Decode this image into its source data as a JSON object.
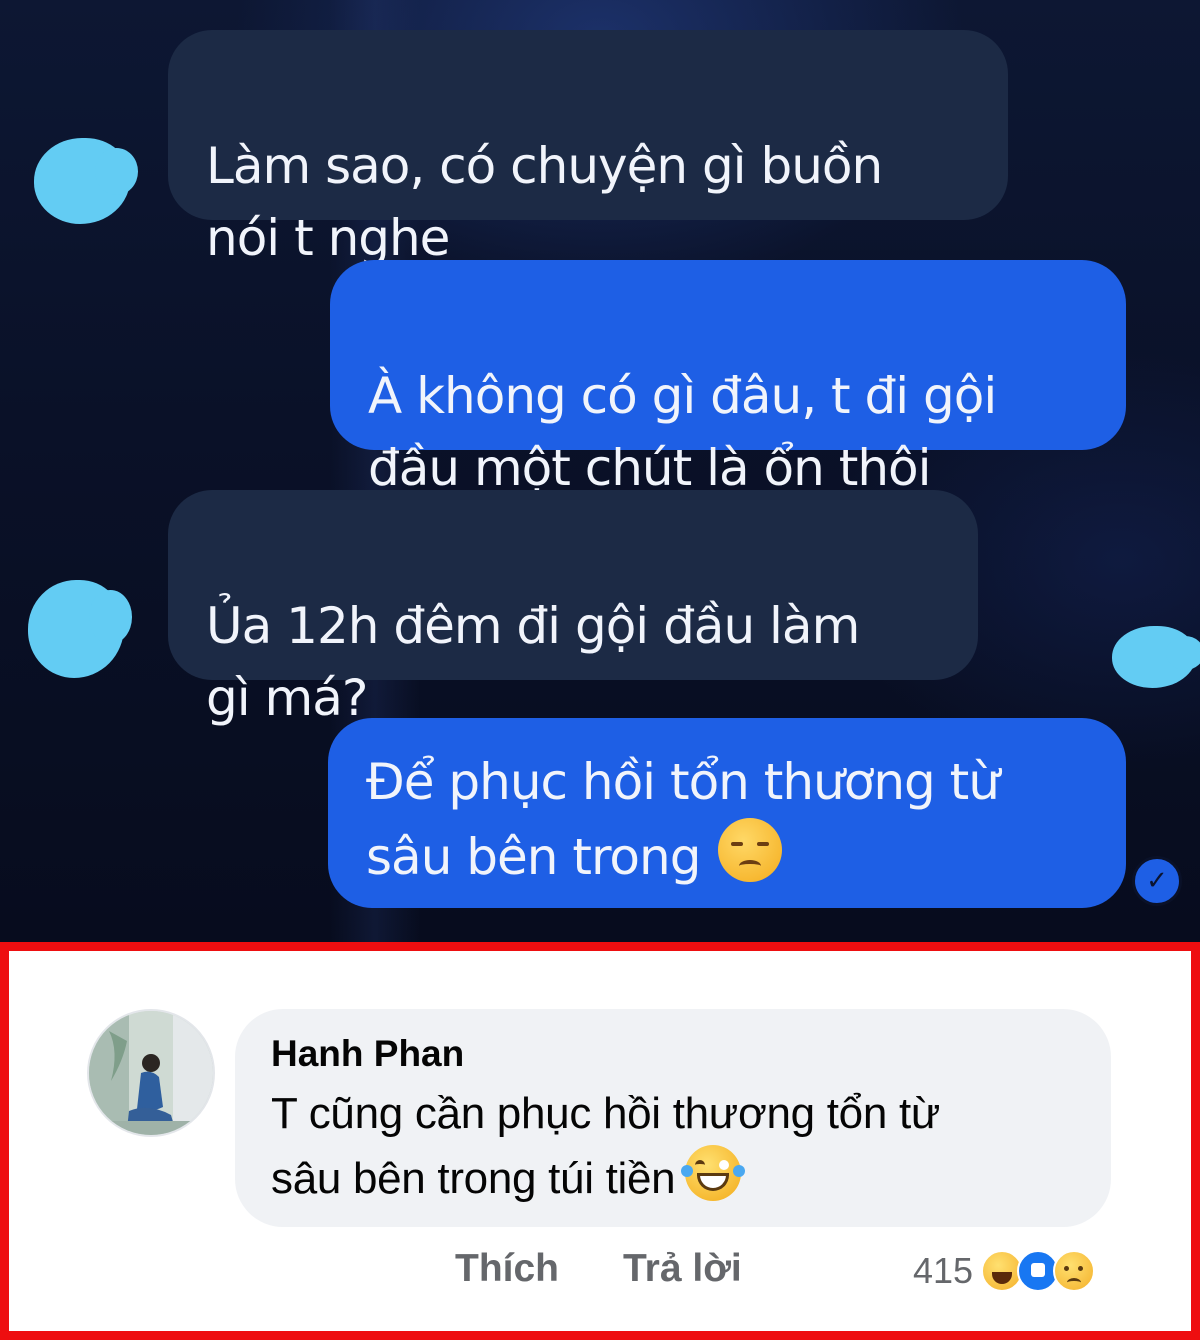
{
  "chat": {
    "messages": [
      {
        "side": "received",
        "text": "Làm sao, có chuyện gì buồn\nnói t nghe"
      },
      {
        "side": "sent",
        "text": "À không có gì đâu, t đi gội\nđầu một chút là ổn thôi"
      },
      {
        "side": "received",
        "text": "Ủa 12h đêm đi gội đầu làm\ngì má?"
      },
      {
        "side": "sent",
        "text": "Để phục hồi tổn thương từ\nsâu bên trong",
        "emoji": "disappointed-face-emoji"
      }
    ],
    "colors": {
      "received_bubble": "#1c2a45",
      "sent_bubble": "#1e5fe5",
      "blurred_avatar": "#63ccf3"
    },
    "seen_icon": "check-icon"
  },
  "comment": {
    "author": "Hanh Phan",
    "text": "T cũng cần phục hồi thương tổn từ\nsâu bên trong túi tiền",
    "emoji": "tears-of-joy-emoji",
    "actions": {
      "like_label": "Thích",
      "reply_label": "Trả lời"
    },
    "reactions": {
      "count": "415",
      "icons": [
        "haha-reaction-icon",
        "like-reaction-icon",
        "sad-reaction-icon"
      ]
    },
    "frame_color": "#ee0e10"
  }
}
